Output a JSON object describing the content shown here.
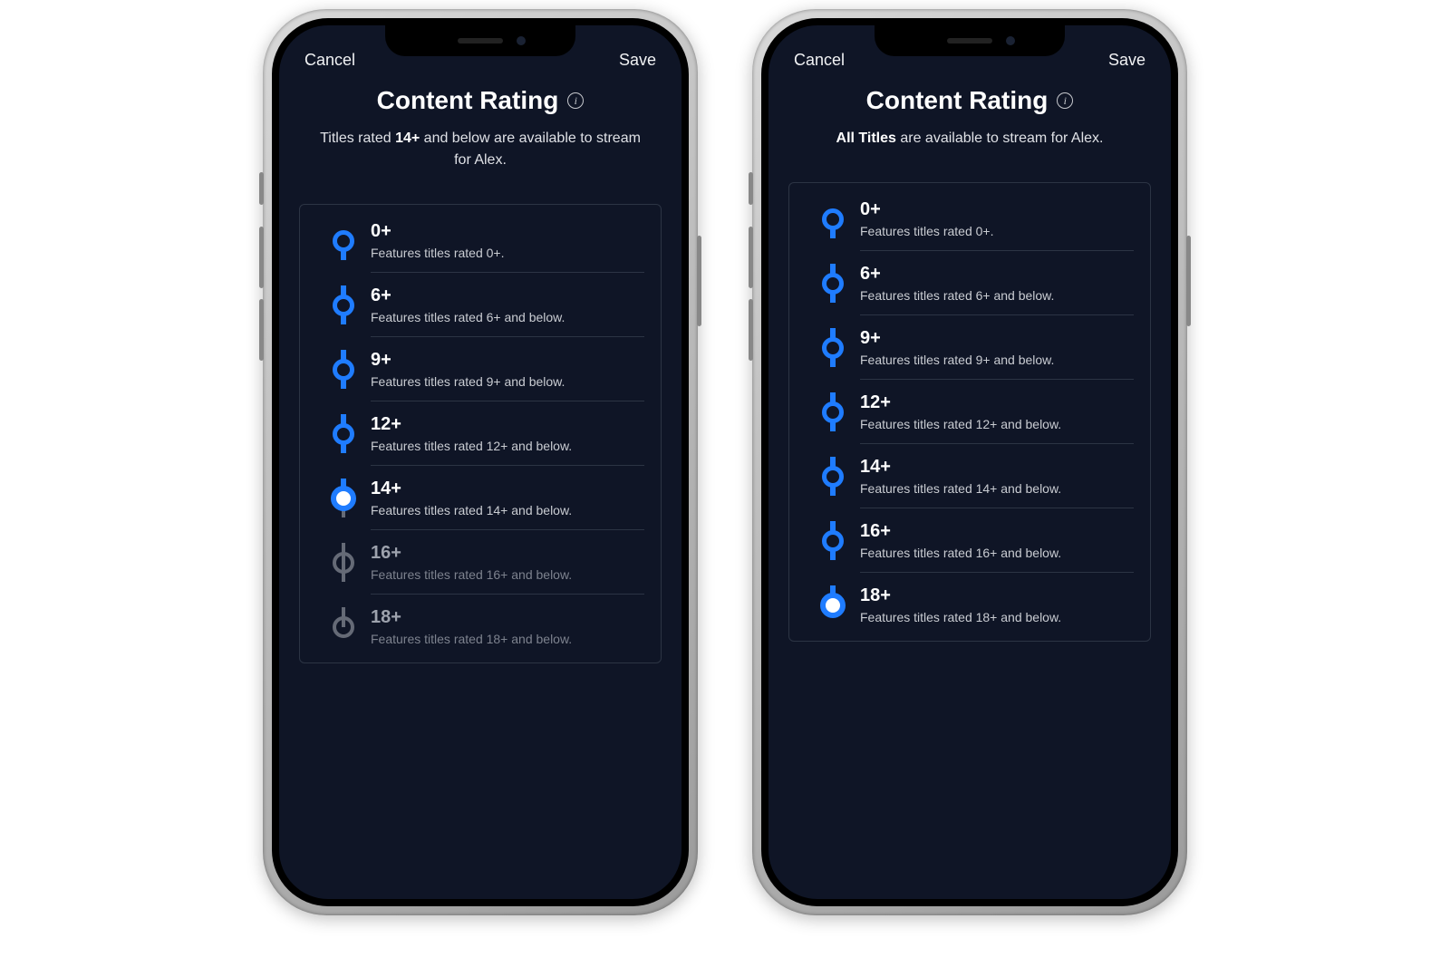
{
  "phones": [
    {
      "cancel": "Cancel",
      "save": "Save",
      "title": "Content Rating",
      "subtitle_pre": "Titles rated ",
      "subtitle_bold": "14+",
      "subtitle_post": " and below are available to stream for Alex.",
      "selected_index": 4,
      "levels": [
        {
          "label": "0+",
          "desc": "Features titles rated 0+."
        },
        {
          "label": "6+",
          "desc": "Features titles rated 6+ and below."
        },
        {
          "label": "9+",
          "desc": "Features titles rated 9+ and below."
        },
        {
          "label": "12+",
          "desc": "Features titles rated 12+ and below."
        },
        {
          "label": "14+",
          "desc": "Features titles rated 14+ and below."
        },
        {
          "label": "16+",
          "desc": "Features titles rated 16+ and below."
        },
        {
          "label": "18+",
          "desc": "Features titles rated 18+ and below."
        }
      ]
    },
    {
      "cancel": "Cancel",
      "save": "Save",
      "title": "Content Rating",
      "subtitle_pre": "",
      "subtitle_bold": "All Titles",
      "subtitle_post": " are available to stream for Alex.",
      "selected_index": 6,
      "levels": [
        {
          "label": "0+",
          "desc": "Features titles rated 0+."
        },
        {
          "label": "6+",
          "desc": "Features titles rated 6+ and below."
        },
        {
          "label": "9+",
          "desc": "Features titles rated 9+ and below."
        },
        {
          "label": "12+",
          "desc": "Features titles rated 12+ and below."
        },
        {
          "label": "14+",
          "desc": "Features titles rated 14+ and below."
        },
        {
          "label": "16+",
          "desc": "Features titles rated 16+ and below."
        },
        {
          "label": "18+",
          "desc": "Features titles rated 18+ and below."
        }
      ]
    }
  ],
  "colors": {
    "accent": "#1f7cff",
    "bg": "#0f1526",
    "divider": "#2c3444",
    "inactive": "#656a76"
  }
}
